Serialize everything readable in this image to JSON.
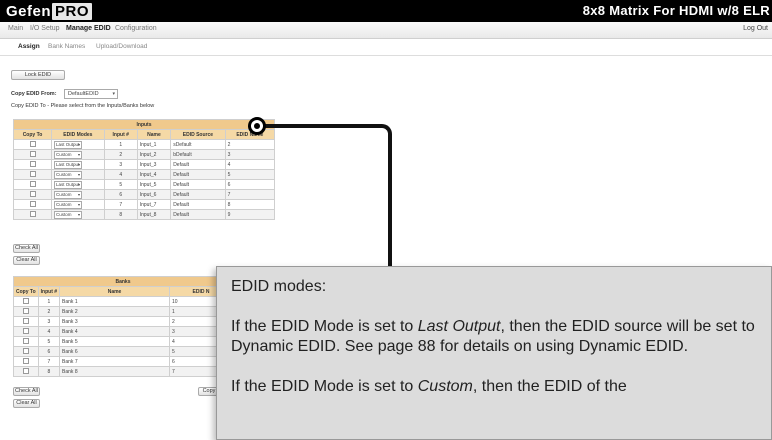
{
  "header": {
    "logo_part1": "Gefen",
    "logo_part2": "PRO",
    "product_title": "8x8 Matrix For HDMI w/8 ELR"
  },
  "nav": {
    "items": [
      "Main",
      "I/O Setup",
      "Manage EDID",
      "Configuration"
    ],
    "active": "Manage EDID",
    "logout": "Log Out"
  },
  "subnav": {
    "items": [
      "Assign",
      "Bank Names",
      "Upload/Download"
    ],
    "active": "Assign"
  },
  "controls": {
    "lock_edid": "Lock EDID",
    "copy_from_label": "Copy EDID From:",
    "copy_from_value": "DefaultEDID",
    "copy_to_note": "Copy EDID To - Please select from the Inputs/Banks below",
    "check_all": "Check All",
    "clear_all": "Clear All",
    "copy": "Copy"
  },
  "inputs_table": {
    "caption": "Inputs",
    "headers": [
      "Copy To",
      "EDID Modes",
      "Input #",
      "Name",
      "EDID Source",
      "EDID Name"
    ],
    "rows": [
      {
        "mode": "Last Output",
        "num": "1",
        "name": "Input_1",
        "source": "sDefault",
        "edid": "2"
      },
      {
        "mode": "Custom",
        "num": "2",
        "name": "Input_2",
        "source": "bDefault",
        "edid": "3"
      },
      {
        "mode": "Last Output",
        "num": "3",
        "name": "Input_3",
        "source": "Default",
        "edid": "4"
      },
      {
        "mode": "Custom",
        "num": "4",
        "name": "Input_4",
        "source": "Default",
        "edid": "5"
      },
      {
        "mode": "Last Output",
        "num": "5",
        "name": "Input_5",
        "source": "Default",
        "edid": "6"
      },
      {
        "mode": "Custom",
        "num": "6",
        "name": "Input_6",
        "source": "Default",
        "edid": "7"
      },
      {
        "mode": "Custom",
        "num": "7",
        "name": "Input_7",
        "source": "Default",
        "edid": "8"
      },
      {
        "mode": "Custom",
        "num": "8",
        "name": "Input_8",
        "source": "Default",
        "edid": "9"
      }
    ]
  },
  "banks_table": {
    "caption": "Banks",
    "headers": [
      "Copy To",
      "Input #",
      "Name",
      "EDID N"
    ],
    "rows": [
      {
        "num": "1",
        "name": "Bank 1",
        "edid": "10"
      },
      {
        "num": "2",
        "name": "Bank 2",
        "edid": "1"
      },
      {
        "num": "3",
        "name": "Bank 3",
        "edid": "2"
      },
      {
        "num": "4",
        "name": "Bank 4",
        "edid": "3"
      },
      {
        "num": "5",
        "name": "Bank 5",
        "edid": "4"
      },
      {
        "num": "6",
        "name": "Bank 6",
        "edid": "5"
      },
      {
        "num": "7",
        "name": "Bank 7",
        "edid": "6"
      },
      {
        "num": "8",
        "name": "Bank 8",
        "edid": "7"
      }
    ]
  },
  "callout": {
    "heading": "EDID modes:",
    "p1_before": "If the EDID Mode is set to ",
    "p1_em": "Last Output",
    "p1_after": ", then the EDID source will be set to Dynamic EDID.  See page 88 for details on using Dynamic EDID.",
    "p2_before": "If the EDID Mode is set to ",
    "p2_em": "Custom",
    "p2_after": ", then the EDID of the"
  }
}
